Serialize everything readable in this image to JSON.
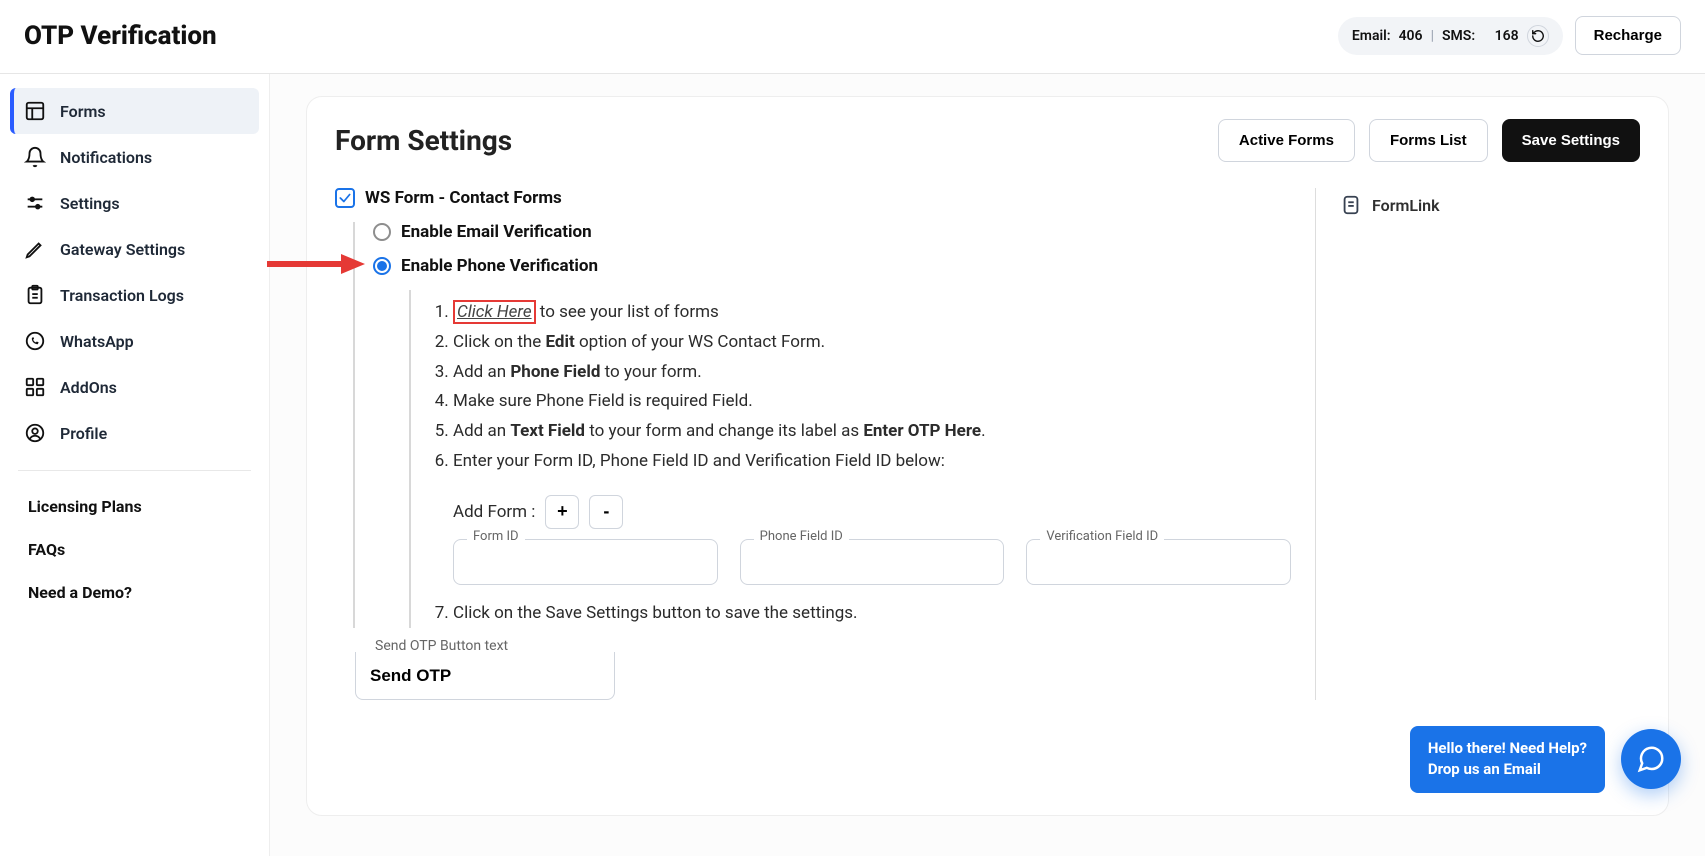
{
  "header": {
    "title": "OTP Verification",
    "email_label": "Email:",
    "email_count": "406",
    "sms_label": "SMS:",
    "sms_count": "168",
    "recharge": "Recharge"
  },
  "sidebar": {
    "items": [
      {
        "label": "Forms"
      },
      {
        "label": "Notifications"
      },
      {
        "label": "Settings"
      },
      {
        "label": "Gateway Settings"
      },
      {
        "label": "Transaction Logs"
      },
      {
        "label": "WhatsApp"
      },
      {
        "label": "AddOns"
      },
      {
        "label": "Profile"
      }
    ],
    "links": [
      {
        "label": "Licensing Plans"
      },
      {
        "label": "FAQs"
      },
      {
        "label": "Need a Demo?"
      }
    ]
  },
  "page": {
    "title": "Form Settings",
    "active_forms": "Active Forms",
    "forms_list": "Forms List",
    "save_settings": "Save Settings"
  },
  "form": {
    "plugin_label": "WS Form - Contact Forms",
    "enable_email": "Enable Email Verification",
    "enable_phone": "Enable Phone Verification",
    "steps": {
      "s1_click": "Click Here",
      "s1_rest": " to see your list of forms",
      "s2_pre": "Click on the ",
      "s2_bold": "Edit",
      "s2_post": " option of your WS Contact Form.",
      "s3_pre": "Add an ",
      "s3_bold": "Phone Field",
      "s3_post": " to your form.",
      "s4": "Make sure Phone Field is required Field.",
      "s5_pre": "Add an ",
      "s5_b1": "Text Field",
      "s5_mid": " to your form and change its label as ",
      "s5_b2": "Enter OTP Here",
      "s5_post": ".",
      "s6": "Enter your Form ID, Phone Field ID and Verification Field ID below:",
      "s7": "Click on the Save Settings button to save the settings."
    },
    "add_form_label": "Add Form :",
    "fields": {
      "form_id": "Form ID",
      "phone_field_id": "Phone Field ID",
      "verification_field_id": "Verification Field ID"
    },
    "send_otp_label": "Send OTP Button text",
    "send_otp_value": "Send OTP"
  },
  "right": {
    "form_link": "FormLink"
  },
  "help": {
    "line1": "Hello there! Need Help?",
    "line2": "Drop us an Email"
  }
}
